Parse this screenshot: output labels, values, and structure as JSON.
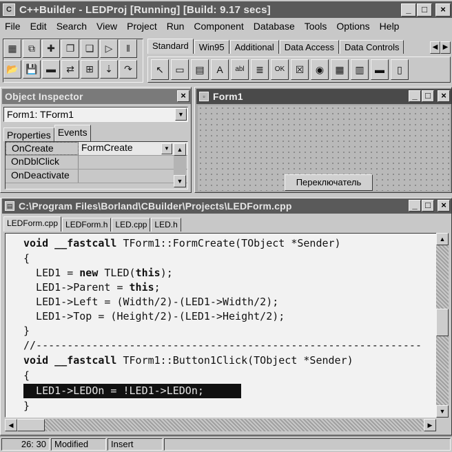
{
  "main_window": {
    "title": "C++Builder - LEDProj [Running] [Build: 9.17 secs]"
  },
  "menu": [
    {
      "label": "File"
    },
    {
      "label": "Edit"
    },
    {
      "label": "Search"
    },
    {
      "label": "View"
    },
    {
      "label": "Project"
    },
    {
      "label": "Run"
    },
    {
      "label": "Component"
    },
    {
      "label": "Database"
    },
    {
      "label": "Tools"
    },
    {
      "label": "Options"
    },
    {
      "label": "Help"
    }
  ],
  "palette": {
    "tabs": [
      "Standard",
      "Win95",
      "Additional",
      "Data Access",
      "Data Controls"
    ],
    "component_glyphs": [
      "↖",
      "▭",
      "▤",
      "A",
      "abl",
      "≣",
      "OK",
      "☒",
      "◉",
      "▦",
      "▥",
      "▬",
      "▯"
    ]
  },
  "object_inspector": {
    "title": "Object Inspector",
    "selected_object": "Form1: TForm1",
    "tabs": [
      "Properties",
      "Events"
    ],
    "events": [
      {
        "name": "OnCreate",
        "value": "FormCreate"
      },
      {
        "name": "OnDblClick",
        "value": ""
      },
      {
        "name": "OnDeactivate",
        "value": ""
      }
    ]
  },
  "form1": {
    "title": "Form1",
    "button_label": "Переключатель"
  },
  "editor": {
    "title": "C:\\Program Files\\Borland\\CBuilder\\Projects\\LEDForm.cpp",
    "tabs": [
      "LEDForm.cpp",
      "LEDForm.h",
      "LED.cpp",
      "LED.h"
    ],
    "lines": {
      "l1": "void __fastcall TForm1::FormCreate(TObject *Sender)",
      "l2": "{",
      "l3": "  LED1 = new TLED(this);",
      "l4": "  LED1->Parent = this;",
      "l5": "  LED1->Left = (Width/2)-(LED1->Width/2);",
      "l6": "  LED1->Top = (Height/2)-(LED1->Height/2);",
      "l7": "}",
      "l8": "//--------------------------------------------------------------",
      "l9": "void __fastcall TForm1::Button1Click(TObject *Sender)",
      "l10": "{",
      "l11": "  LED1->LEDOn = !LED1->LEDOn;",
      "l12": "}"
    }
  },
  "statusbar": {
    "position": "26: 30",
    "modified": "Modified",
    "mode": "Insert"
  }
}
